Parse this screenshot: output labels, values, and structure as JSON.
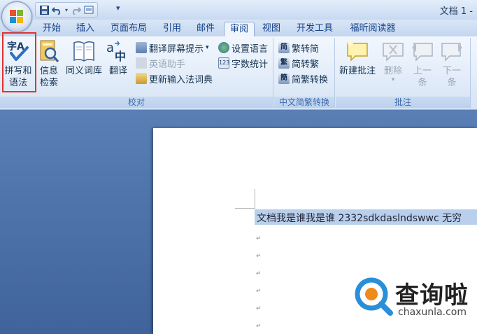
{
  "title_bar": {
    "doc_title": "文档 1 -",
    "quick_access": [
      "save-icon",
      "undo-icon",
      "redo-icon",
      "print-preview-icon"
    ],
    "customize_glyph": "▾"
  },
  "tabs": [
    "开始",
    "插入",
    "页面布局",
    "引用",
    "邮件",
    "审阅",
    "视图",
    "开发工具",
    "福昕阅读器"
  ],
  "active_tab": "审阅",
  "ribbon": {
    "proofing": {
      "label": "校对",
      "spelling_line1": "拼写和",
      "spelling_line2": "语法",
      "research_line1": "信息",
      "research_line2": "检索",
      "thesaurus": "同义词库",
      "translate": "翻译",
      "translate_tip": "翻译屏幕提示",
      "translate_tip_arrow": "▾",
      "english_assistant": "英语助手",
      "ime_dictionary": "更新输入法词典",
      "set_language": "设置语言",
      "word_count": "字数统计"
    },
    "chinese_conversion": {
      "label": "中文简繁转换",
      "to_simplified": "繁转简",
      "to_traditional": "简转繁",
      "convert": "简繁转换"
    },
    "comments": {
      "label": "批注",
      "new_comment": "新建批注",
      "delete": "删除",
      "delete_arrow": "▾",
      "previous_line1": "上一",
      "previous_line2": "条",
      "next_line1": "下一",
      "next_line2": "条"
    }
  },
  "document": {
    "selected_text": "文档我是谁我是谁 2332sdkdaslndswwc 无穷",
    "paragraph_mark": "↵"
  },
  "watermark": {
    "brand": "查询啦",
    "domain": "chaxunla.com"
  },
  "colors": {
    "highlight_box": "#e0332f",
    "ribbon_text": "#15428b",
    "doc_background": "#3f639a",
    "selection": "#b9d0ec"
  }
}
